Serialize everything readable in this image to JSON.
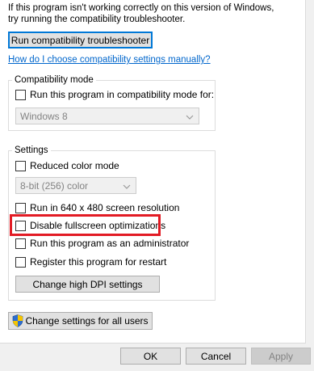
{
  "intro": {
    "line1": "If this program isn't working correctly on this version of Windows,",
    "line2": "try running the compatibility troubleshooter."
  },
  "run_troubleshooter_label": "Run compatibility troubleshooter",
  "help_link": "How do I choose compatibility settings manually?",
  "compat_mode": {
    "legend": "Compatibility mode",
    "checkbox_label": "Run this program in compatibility mode for:",
    "os_select_value": "Windows 8"
  },
  "settings": {
    "legend": "Settings",
    "reduced_color_label": "Reduced color mode",
    "color_select_value": "8-bit (256) color",
    "resolution_label": "Run in 640 x 480 screen resolution",
    "fullscreen_label": "Disable fullscreen optimizations",
    "admin_label": "Run this program as an administrator",
    "restart_label": "Register this program for restart",
    "dpi_button_label": "Change high DPI settings"
  },
  "all_users_button_label": "Change settings for all users",
  "footer": {
    "ok_label": "OK",
    "cancel_label": "Cancel",
    "apply_label": "Apply"
  },
  "colors": {
    "highlight": "#e21b24",
    "link": "#0066cc",
    "focus_border": "#0078d7"
  }
}
